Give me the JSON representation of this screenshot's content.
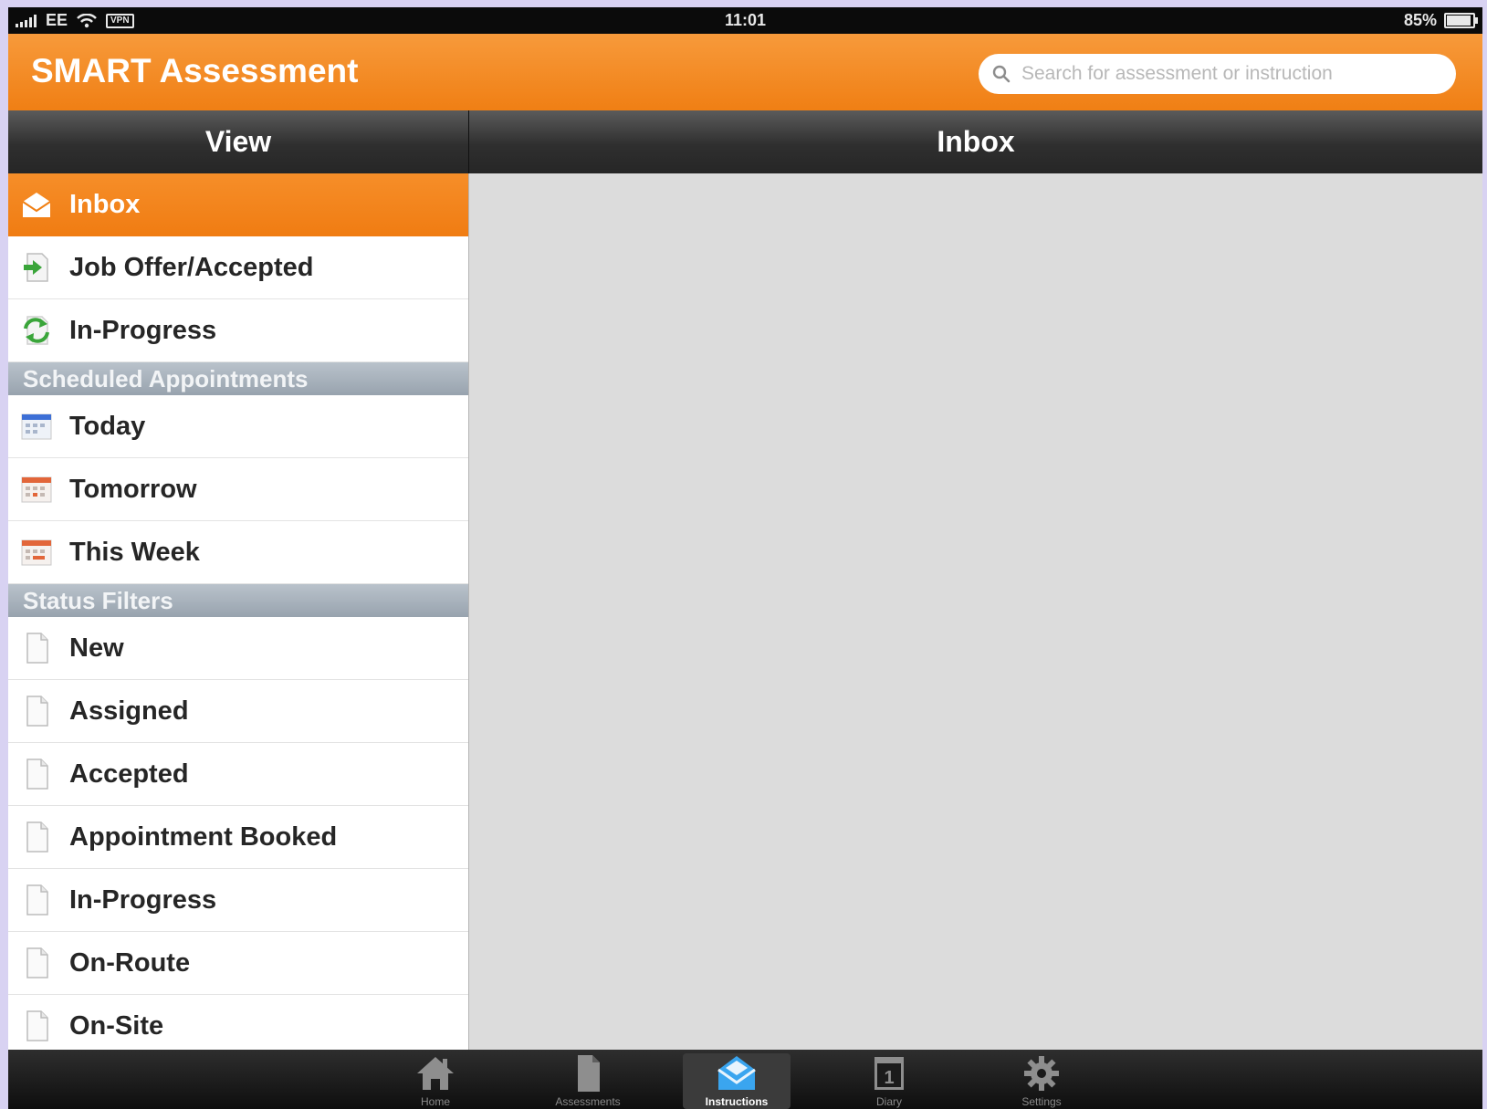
{
  "status_bar": {
    "carrier": "EE",
    "vpn": "VPN",
    "time": "11:01",
    "battery_text": "85%",
    "battery_level": 0.85
  },
  "app": {
    "title": "SMART Assessment",
    "search_placeholder": "Search for assessment or instruction",
    "accent_color": "#f07f14"
  },
  "headers": {
    "left": "View",
    "right": "Inbox"
  },
  "sidebar": {
    "top_items": [
      {
        "label": "Inbox",
        "icon": "inbox-icon",
        "active": true
      },
      {
        "label": "Job Offer/Accepted",
        "icon": "job-offer-arrow-icon"
      },
      {
        "label": "In-Progress",
        "icon": "sync-arrows-icon"
      }
    ],
    "scheduled_header": "Scheduled Appointments",
    "scheduled_items": [
      {
        "label": "Today",
        "icon": "calendar-icon"
      },
      {
        "label": "Tomorrow",
        "icon": "calendar-icon"
      },
      {
        "label": "This Week",
        "icon": "calendar-icon"
      }
    ],
    "status_header": "Status Filters",
    "status_items": [
      {
        "label": "New",
        "icon": "document-icon"
      },
      {
        "label": "Assigned",
        "icon": "document-icon"
      },
      {
        "label": "Accepted",
        "icon": "document-icon"
      },
      {
        "label": "Appointment Booked",
        "icon": "document-icon"
      },
      {
        "label": "In-Progress",
        "icon": "document-icon"
      },
      {
        "label": "On-Route",
        "icon": "document-icon"
      },
      {
        "label": "On-Site",
        "icon": "document-icon"
      }
    ]
  },
  "tabbar": {
    "tabs": [
      {
        "label": "Home",
        "icon": "home-icon"
      },
      {
        "label": "Assessments",
        "icon": "assessments-icon"
      },
      {
        "label": "Instructions",
        "icon": "instructions-icon",
        "active": true
      },
      {
        "label": "Diary",
        "icon": "diary-icon",
        "badge": "1"
      },
      {
        "label": "Settings",
        "icon": "settings-gear-icon"
      }
    ]
  }
}
